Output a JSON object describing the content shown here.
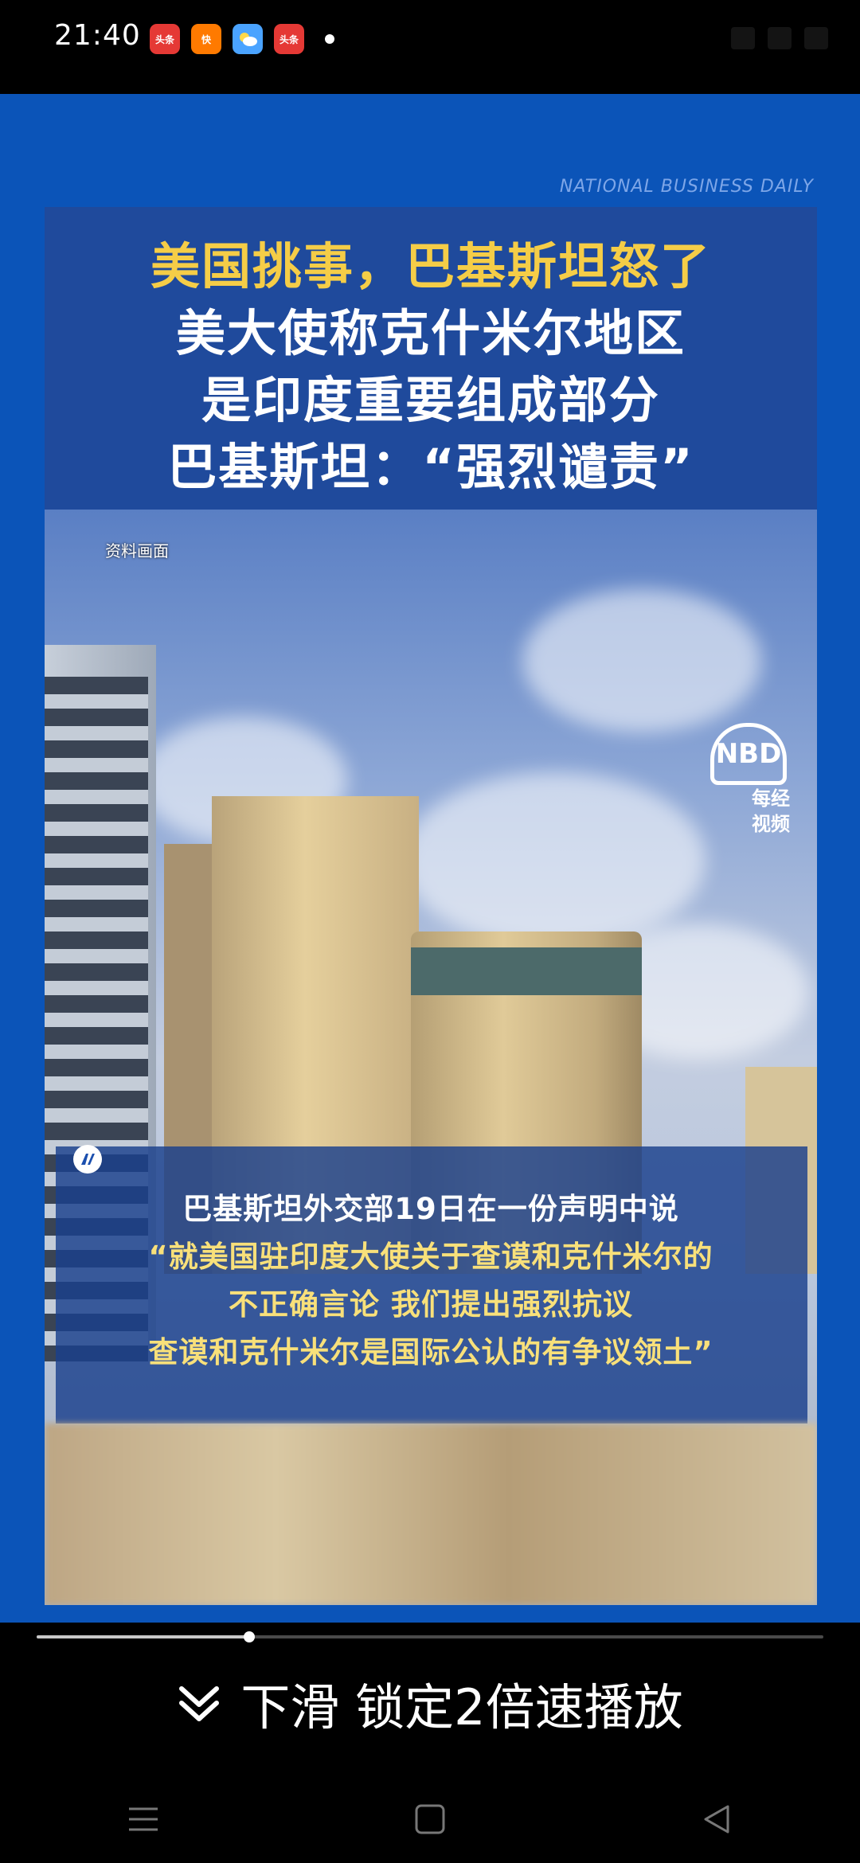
{
  "status_bar": {
    "time": "21:40",
    "notification_apps": [
      {
        "name": "toutiao-icon",
        "label": "头条"
      },
      {
        "name": "kuaishou-icon",
        "label": "快"
      },
      {
        "name": "weather-icon",
        "label": ""
      },
      {
        "name": "toutiao-icon-2",
        "label": "头条"
      }
    ]
  },
  "video": {
    "watermark_text": "NATIONAL BUSINESS DAILY",
    "title_lines": [
      "美国挑事，巴基斯坦怒了",
      "美大使称克什米尔地区",
      "是印度重要组成部分",
      "巴基斯坦：“强烈谴责”"
    ],
    "source_label": "资料画面",
    "logo": {
      "mark": "NBD",
      "name_line1": "每经",
      "name_line2": "视频"
    },
    "caption_lines": [
      "巴基斯坦外交部19日在一份声明中说",
      "“就美国驻印度大使关于查谟和克什米尔的",
      "不正确言论 我们提出强烈抗议",
      "查谟和克什米尔是国际公认的有争议领土”"
    ],
    "colors": {
      "background": "#0b54b8",
      "title_highlight": "#f5cd47",
      "caption_highlight": "#f8e07a"
    }
  },
  "player": {
    "progress": 0.27,
    "swipe_hint": "下滑 锁定2倍速播放"
  },
  "nav_bar": {
    "icons": [
      "menu-icon",
      "home-icon",
      "back-icon"
    ]
  }
}
